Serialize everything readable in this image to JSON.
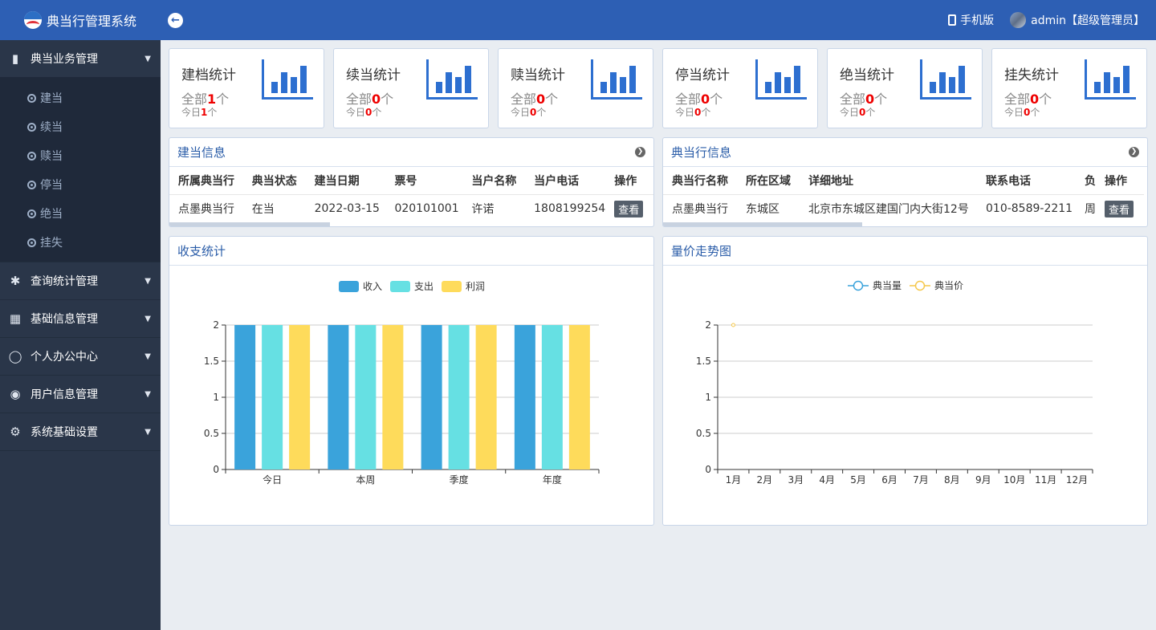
{
  "app": {
    "title": "典当行管理系统"
  },
  "sidebar": {
    "groups": [
      {
        "label": "典当业务管理",
        "icon": "book-icon",
        "expanded": true,
        "items": [
          {
            "label": "建当"
          },
          {
            "label": "续当"
          },
          {
            "label": "赎当"
          },
          {
            "label": "停当"
          },
          {
            "label": "绝当"
          },
          {
            "label": "挂失"
          }
        ]
      },
      {
        "label": "查询统计管理",
        "icon": "asterisk-icon"
      },
      {
        "label": "基础信息管理",
        "icon": "grid-icon"
      },
      {
        "label": "个人办公中心",
        "icon": "user-outline-icon"
      },
      {
        "label": "用户信息管理",
        "icon": "user-circle-icon"
      },
      {
        "label": "系统基础设置",
        "icon": "gear-icon"
      }
    ]
  },
  "topbar": {
    "mobile_label": "手机版",
    "user_label": "admin【超级管理员】"
  },
  "stats": {
    "total_prefix": "全部",
    "today_prefix": "今日",
    "unit": "个",
    "cards": [
      {
        "title": "建档统计",
        "total": "1",
        "today": "1"
      },
      {
        "title": "续当统计",
        "total": "0",
        "today": "0"
      },
      {
        "title": "赎当统计",
        "total": "0",
        "today": "0"
      },
      {
        "title": "停当统计",
        "total": "0",
        "today": "0"
      },
      {
        "title": "绝当统计",
        "total": "0",
        "today": "0"
      },
      {
        "title": "挂失统计",
        "total": "0",
        "today": "0"
      }
    ]
  },
  "pawn_info": {
    "title": "建当信息",
    "columns": [
      "所属典当行",
      "典当状态",
      "建当日期",
      "票号",
      "当户名称",
      "当户电话",
      "操作"
    ],
    "rows": [
      [
        "点墨典当行",
        "在当",
        "2022-03-15",
        "020101001",
        "许诺",
        "1808199254"
      ]
    ],
    "action_label": "查看"
  },
  "shop_info": {
    "title": "典当行信息",
    "columns": [
      "典当行名称",
      "所在区域",
      "详细地址",
      "联系电话",
      "负",
      "操作"
    ],
    "rows": [
      [
        "点墨典当行",
        "东城区",
        "北京市东城区建国门内大街12号",
        "010-8589-2211",
        "周"
      ]
    ],
    "action_label": "查看"
  },
  "income_chart": {
    "panel_title": "收支统计"
  },
  "trend_chart": {
    "panel_title": "量价走势图"
  },
  "chart_data": [
    {
      "type": "bar",
      "categories": [
        "今日",
        "本周",
        "季度",
        "年度"
      ],
      "series": [
        {
          "name": "收入",
          "values": [
            2,
            2,
            2,
            2
          ],
          "color": "#3aa3db"
        },
        {
          "name": "支出",
          "values": [
            2,
            2,
            2,
            2
          ],
          "color": "#66e0e3"
        },
        {
          "name": "利润",
          "values": [
            2,
            2,
            2,
            2
          ],
          "color": "#fedb5b"
        }
      ],
      "ylim": [
        0,
        2
      ],
      "yticks": [
        0,
        0.5,
        1,
        1.5,
        2
      ],
      "legend": "top-center",
      "grid": true
    },
    {
      "type": "line",
      "categories": [
        "1月",
        "2月",
        "3月",
        "4月",
        "5月",
        "6月",
        "7月",
        "8月",
        "9月",
        "10月",
        "11月",
        "12月"
      ],
      "series": [
        {
          "name": "典当量",
          "values": [],
          "color": "#3aa3db"
        },
        {
          "name": "典当价",
          "values": [
            2
          ],
          "color": "#f5c84c"
        }
      ],
      "ylim": [
        0,
        2
      ],
      "yticks": [
        0,
        0.5,
        1,
        1.5,
        2
      ],
      "legend": "top-center",
      "grid": true
    }
  ]
}
